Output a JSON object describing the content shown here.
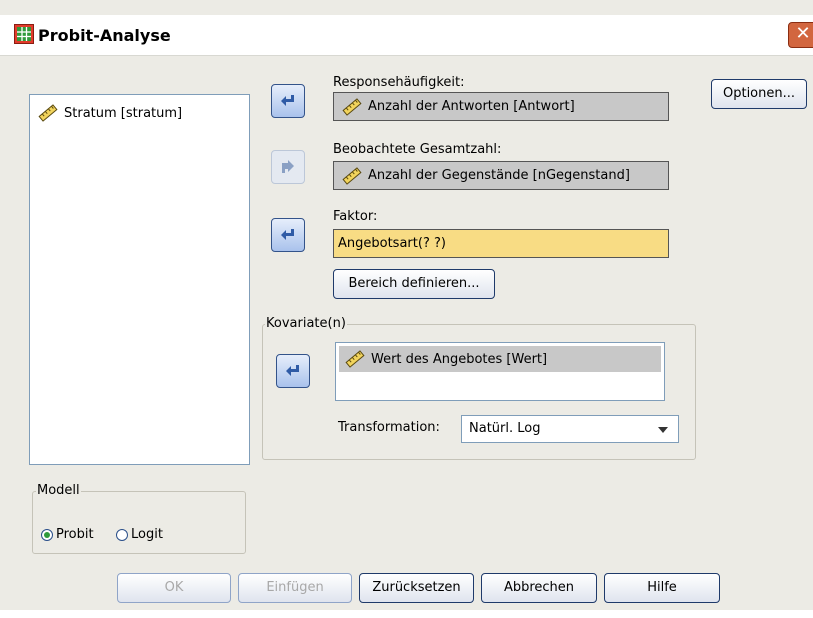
{
  "window": {
    "title": "Probit-Analyse",
    "close_label": "✕",
    "app_icon": "table-icon"
  },
  "source_list": {
    "items": [
      {
        "label": "Stratum [stratum]",
        "icon": "ruler-icon"
      }
    ]
  },
  "response": {
    "label": "Responsehäufigkeit:",
    "value": "Anzahl der Antworten [Antwort]"
  },
  "observed_total": {
    "label": "Beobachtete Gesamtzahl:",
    "value": "Anzahl der Gegenstände [nGegenstand]"
  },
  "factor": {
    "label": "Faktor:",
    "value": "Angebotsart(? ?)",
    "define_range_label": "Bereich definieren..."
  },
  "covariates": {
    "group_label": "Kovariate(n)",
    "items": [
      {
        "label": "Wert des Angebotes [Wert]",
        "icon": "ruler-icon"
      }
    ],
    "transformation_label": "Transformation:",
    "transformation_value": "Natürl. Log"
  },
  "model": {
    "group_label": "Modell",
    "options": [
      {
        "label": "Probit",
        "selected": true
      },
      {
        "label": "Logit",
        "selected": false
      }
    ]
  },
  "side_buttons": {
    "options_label": "Optionen..."
  },
  "buttons": {
    "ok": "OK",
    "paste": "Einfügen",
    "reset": "Zurücksetzen",
    "cancel": "Abbrechen",
    "help": "Hilfe"
  },
  "colors": {
    "arrow_blue": "#2f5ba6",
    "selected_field": "#c8c8c8",
    "factor_field": "#f8dc84",
    "title_close": "#d2663f"
  }
}
